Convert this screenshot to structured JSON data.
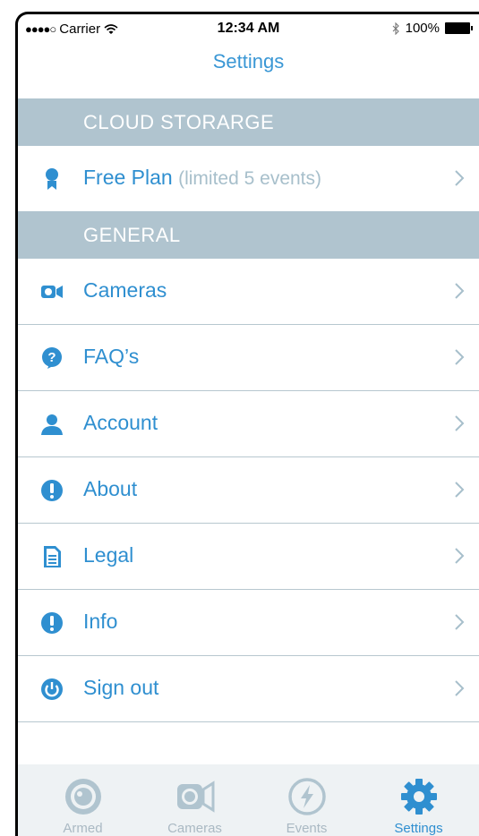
{
  "status_bar": {
    "signal": "●●●●○",
    "carrier": "Carrier",
    "time": "12:34 AM",
    "battery": "100%"
  },
  "nav": {
    "title": "Settings"
  },
  "sections": {
    "cloud": "CLOUD STORARGE",
    "general": "GENERAL"
  },
  "plan_row": {
    "label": "Free Plan",
    "detail": "(limited 5 events)",
    "icon": "ribbon-icon"
  },
  "rows": [
    {
      "label": "Cameras",
      "icon": "camera-icon"
    },
    {
      "label": "FAQ’s",
      "icon": "question-icon"
    },
    {
      "label": "Account",
      "icon": "user-icon"
    },
    {
      "label": "About",
      "icon": "exclamation-icon"
    },
    {
      "label": "Legal",
      "icon": "document-icon"
    },
    {
      "label": "Info",
      "icon": "exclamation-icon"
    },
    {
      "label": "Sign out",
      "icon": "power-icon"
    }
  ],
  "tabs": [
    {
      "label": "Armed",
      "icon": "armed-icon",
      "active": false
    },
    {
      "label": "Cameras",
      "icon": "camera-icon",
      "active": false
    },
    {
      "label": "Events",
      "icon": "bolt-icon",
      "active": false
    },
    {
      "label": "Settings",
      "icon": "gear-icon",
      "active": true
    }
  ],
  "colors": {
    "accent": "#3a97d5",
    "section_bg": "#b0c4cf",
    "muted": "#a7bfcb",
    "tab_bg": "#eef2f4",
    "tab_inactive": "#aab9c3"
  }
}
